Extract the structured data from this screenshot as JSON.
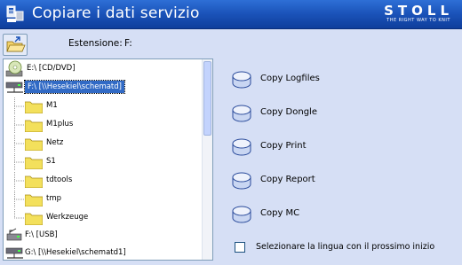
{
  "window": {
    "title": "Copiare i dati servizio",
    "logo_main": "STOLL",
    "logo_sub": "THE RIGHT WAY TO KNIT"
  },
  "extension": {
    "label": "Estensione:",
    "value": "F:"
  },
  "tree": [
    {
      "label": "E:\\  [CD/DVD]",
      "icon": "cd-dvd-drive-icon",
      "level": 0
    },
    {
      "label": "F:\\  [\\\\Hesekiel\\schematd]",
      "icon": "network-drive-icon",
      "level": 0,
      "selected": true
    },
    {
      "label": "M1",
      "icon": "folder-icon",
      "level": 1
    },
    {
      "label": "M1plus",
      "icon": "folder-icon",
      "level": 1
    },
    {
      "label": "Netz",
      "icon": "folder-icon",
      "level": 1
    },
    {
      "label": "S1",
      "icon": "folder-icon",
      "level": 1
    },
    {
      "label": "tdtools",
      "icon": "folder-icon",
      "level": 1
    },
    {
      "label": "tmp",
      "icon": "folder-icon",
      "level": 1
    },
    {
      "label": "Werkzeuge",
      "icon": "folder-icon",
      "level": 1
    },
    {
      "label": "F:\\  [USB]",
      "icon": "usb-drive-icon",
      "level": 0
    },
    {
      "label": "G:\\  [\\\\Hesekiel\\schematd1]",
      "icon": "network-drive-icon",
      "level": 0
    }
  ],
  "actions": [
    {
      "label": "Copy Logfiles"
    },
    {
      "label": "Copy Dongle"
    },
    {
      "label": "Copy Print"
    },
    {
      "label": "Copy Report"
    },
    {
      "label": "Copy MC"
    }
  ],
  "language_option": {
    "label": "Selezionare la lingua con il prossimo inizio",
    "checked": false
  },
  "colors": {
    "titlebar": "#1a52b8",
    "background": "#d6dff5",
    "selection": "#316ac5"
  }
}
